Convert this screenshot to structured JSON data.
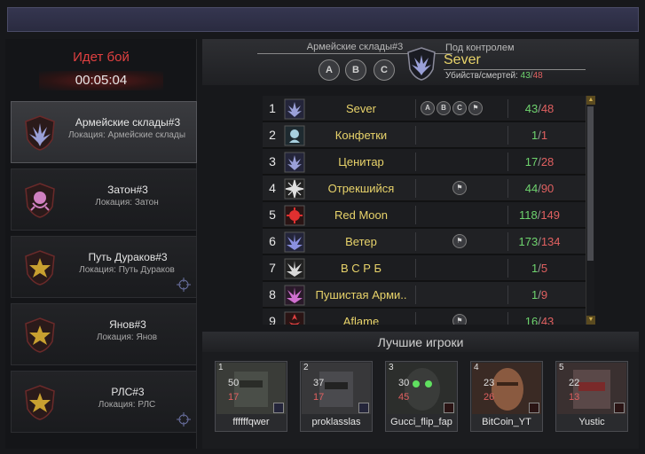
{
  "battle": {
    "status": "Идет бой",
    "timer": "00:05:04"
  },
  "locations": [
    {
      "name": "Армейские склады#3",
      "sub": "Локация: Армейские склады",
      "active": true
    },
    {
      "name": "Затон#3",
      "sub": "Локация: Затон"
    },
    {
      "name": "Путь Дураков#3",
      "sub": "Локация: Путь Дураков"
    },
    {
      "name": "Янов#3",
      "sub": "Локация: Янов"
    },
    {
      "name": "РЛС#3",
      "sub": "Локация: РЛС"
    }
  ],
  "header": {
    "location_title": "Армейские склады#3",
    "points": [
      "A",
      "B",
      "C"
    ],
    "control_label": "Под контролем",
    "control_name": "Sever",
    "kd_label": "Убийств/смертей:",
    "kd_kills": "43",
    "kd_deaths": "48"
  },
  "clans": [
    {
      "rank": "1",
      "name": "Sever",
      "kills": "43",
      "deaths": "48",
      "points": [
        "A",
        "B",
        "C",
        "flag"
      ]
    },
    {
      "rank": "2",
      "name": "Конфетки",
      "kills": "1",
      "deaths": "1",
      "points": []
    },
    {
      "rank": "3",
      "name": "Ценитар",
      "kills": "17",
      "deaths": "28",
      "points": []
    },
    {
      "rank": "4",
      "name": "Отрекшийся",
      "kills": "44",
      "deaths": "90",
      "points": [
        "flag"
      ]
    },
    {
      "rank": "5",
      "name": "Red Moon",
      "kills": "118",
      "deaths": "149",
      "points": []
    },
    {
      "rank": "6",
      "name": "Ветер",
      "kills": "173",
      "deaths": "134",
      "points": [
        "flag"
      ]
    },
    {
      "rank": "7",
      "name": "В С Р Б",
      "kills": "1",
      "deaths": "5",
      "points": []
    },
    {
      "rank": "8",
      "name": "Пушистая Арми..",
      "kills": "1",
      "deaths": "9",
      "points": []
    },
    {
      "rank": "9",
      "name": "Aflame",
      "kills": "16",
      "deaths": "43",
      "points": [
        "flag"
      ]
    }
  ],
  "best_players": {
    "title": "Лучшие игроки",
    "players": [
      {
        "rank": "1",
        "name": "ffffffqwer",
        "kills": "50",
        "deaths": "17"
      },
      {
        "rank": "2",
        "name": "proklasslas",
        "kills": "37",
        "deaths": "17"
      },
      {
        "rank": "3",
        "name": "Gucci_flip_fap",
        "kills": "30",
        "deaths": "45"
      },
      {
        "rank": "4",
        "name": "BitCoin_YT",
        "kills": "23",
        "deaths": "26"
      },
      {
        "rank": "5",
        "name": "Yustic",
        "kills": "22",
        "deaths": "13"
      }
    ]
  },
  "colors": {
    "accent_yellow": "#e8d36a",
    "kills_green": "#6ed46e",
    "deaths_red": "#e06060",
    "status_red": "#e04040"
  }
}
